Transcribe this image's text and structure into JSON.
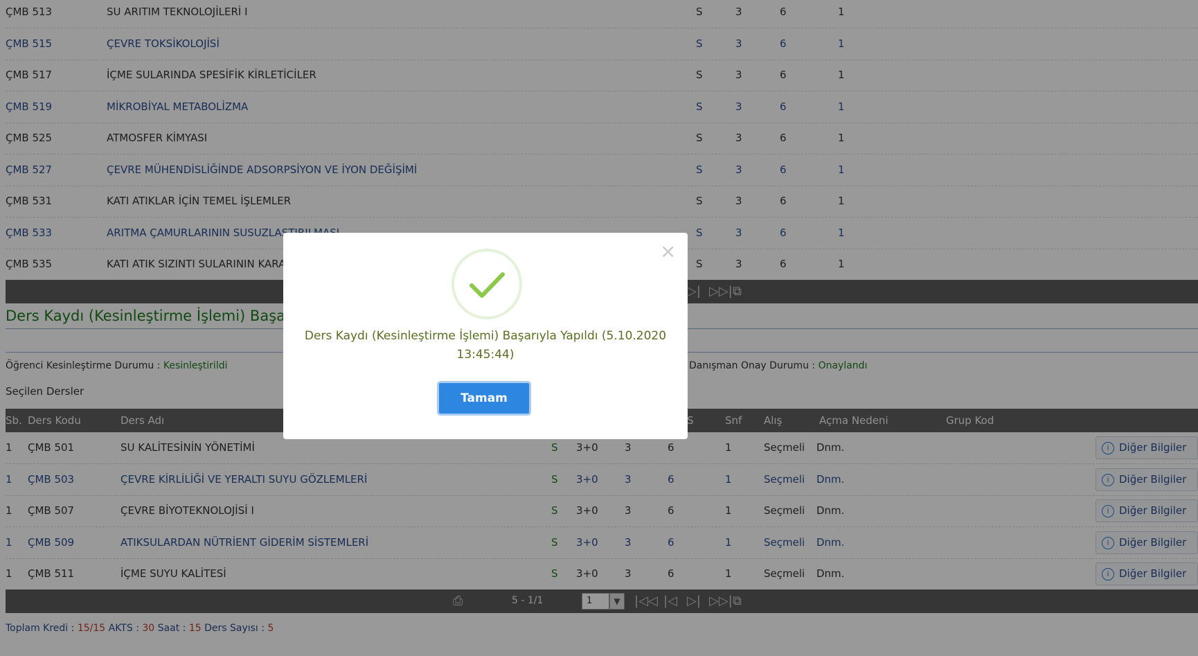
{
  "top_courses": [
    {
      "code": "ÇMB 513",
      "name": "SU ARITIM TEKNOLOJİLERİ I",
      "type": "S",
      "hours": "3",
      "ects": "6",
      "semester": "1"
    },
    {
      "code": "ÇMB 515",
      "name": "ÇEVRE TOKSİKOLOJİSİ",
      "type": "S",
      "hours": "3",
      "ects": "6",
      "semester": "1"
    },
    {
      "code": "ÇMB 517",
      "name": "İÇME SULARINDA SPESİFİK KİRLETİCİLER",
      "type": "S",
      "hours": "3",
      "ects": "6",
      "semester": "1"
    },
    {
      "code": "ÇMB 519",
      "name": "MİKROBİYAL METABOLİZMA",
      "type": "S",
      "hours": "3",
      "ects": "6",
      "semester": "1"
    },
    {
      "code": "ÇMB 525",
      "name": "ATMOSFER KİMYASI",
      "type": "S",
      "hours": "3",
      "ects": "6",
      "semester": "1"
    },
    {
      "code": "ÇMB 527",
      "name": "ÇEVRE MÜHENDİSLİĞİNDE ADSORPSİYON VE İYON DEĞİŞİMİ",
      "type": "S",
      "hours": "3",
      "ects": "6",
      "semester": "1"
    },
    {
      "code": "ÇMB 531",
      "name": "KATI ATIKLAR İÇİN TEMEL İŞLEMLER",
      "type": "S",
      "hours": "3",
      "ects": "6",
      "semester": "1"
    },
    {
      "code": "ÇMB 533",
      "name": "ARITMA ÇAMURLARININ SUSUZLAŞTIRILMASI",
      "type": "S",
      "hours": "3",
      "ects": "6",
      "semester": "1"
    },
    {
      "code": "ÇMB 535",
      "name": "KATI ATIK SIZINTI SULARININ KARAKTERİZASYONU",
      "type": "S",
      "hours": "3",
      "ects": "6",
      "semester": "1"
    }
  ],
  "result_title": "Ders Kaydı (Kesinleştirme İşlemi) Başarıyla Yapıldı (5.10.2020 13:45:44)",
  "status": {
    "student_label": "Öğrenci Kesinleştirme Durumu :",
    "student_value": "Kesinleştirildi",
    "advisor_label": "Danışman Onay Durumu :",
    "advisor_value": "Onaylandı"
  },
  "selected_title": "Seçilen Dersler",
  "headers": {
    "no": "Sb.",
    "code": "Ders Kodu",
    "name": "Ders Adı",
    "ects": "AKTS",
    "snf": "Snf",
    "alis": "Alış",
    "acma": "Açma Nedeni",
    "grup": "Grup Kod"
  },
  "selected_courses": [
    {
      "no": "1",
      "code": "ÇMB 501",
      "name": "SU KALİTESİNİN YÖNETİMİ",
      "type": "S",
      "ds": "3+0",
      "credit": "3",
      "ects": "6",
      "snf": "1",
      "alis": "Seçmeli",
      "acma": "Dnm."
    },
    {
      "no": "1",
      "code": "ÇMB 503",
      "name": "ÇEVRE KİRLİLİĞİ VE YERALTI SUYU GÖZLEMLERİ",
      "type": "S",
      "ds": "3+0",
      "credit": "3",
      "ects": "6",
      "snf": "1",
      "alis": "Seçmeli",
      "acma": "Dnm."
    },
    {
      "no": "1",
      "code": "ÇMB 507",
      "name": "ÇEVRE BİYOTEKNOLOJİSİ I",
      "type": "S",
      "ds": "3+0",
      "credit": "3",
      "ects": "6",
      "snf": "1",
      "alis": "Seçmeli",
      "acma": "Dnm."
    },
    {
      "no": "1",
      "code": "ÇMB 509",
      "name": "ATIKSULARDAN NÜTRİENT GİDERİM SİSTEMLERİ",
      "type": "S",
      "ds": "3+0",
      "credit": "3",
      "ects": "6",
      "snf": "1",
      "alis": "Seçmeli",
      "acma": "Dnm."
    },
    {
      "no": "1",
      "code": "ÇMB 511",
      "name": "İÇME SUYU KALİTESİ",
      "type": "S",
      "ds": "3+0",
      "credit": "3",
      "ects": "6",
      "snf": "1",
      "alis": "Seçmeli",
      "acma": "Dnm."
    }
  ],
  "other_info_label": "Diğer Bilgiler",
  "pager": {
    "range": "5 - 1/1",
    "page": "1"
  },
  "totals": {
    "kredi_label": "Toplam Kredi :",
    "kredi": "15/15",
    "akts_label": "AKTS :",
    "akts": "30",
    "saat_label": "Saat :",
    "saat": "15",
    "sayi_label": "Ders Sayısı :",
    "sayi": "5"
  },
  "modal": {
    "message": "Ders Kaydı (Kesinleştirme İşlemi) Başarıyla Yapıldı (5.10.2020 13:45:44)",
    "ok": "Tamam"
  }
}
